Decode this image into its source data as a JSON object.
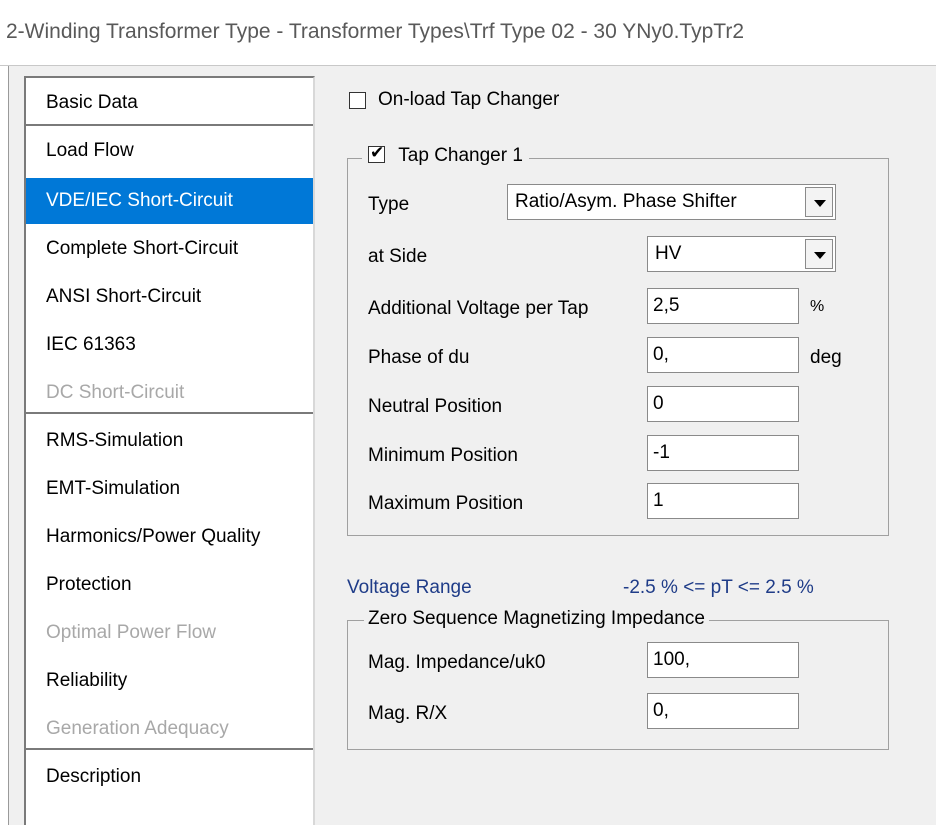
{
  "window": {
    "title": "2-Winding Transformer Type - Transformer Types\\Trf Type 02 - 30 YNy0.TypTr2"
  },
  "sidebar": {
    "items": [
      {
        "label": "Basic Data",
        "state": "normal"
      },
      {
        "label": "Load Flow",
        "state": "normal"
      },
      {
        "label": "VDE/IEC Short-Circuit",
        "state": "selected"
      },
      {
        "label": "Complete Short-Circuit",
        "state": "normal"
      },
      {
        "label": "ANSI Short-Circuit",
        "state": "normal"
      },
      {
        "label": "IEC 61363",
        "state": "normal"
      },
      {
        "label": "DC Short-Circuit",
        "state": "disabled"
      },
      {
        "label": "RMS-Simulation",
        "state": "normal"
      },
      {
        "label": "EMT-Simulation",
        "state": "normal"
      },
      {
        "label": "Harmonics/Power Quality",
        "state": "normal"
      },
      {
        "label": "Protection",
        "state": "normal"
      },
      {
        "label": "Optimal Power Flow",
        "state": "disabled"
      },
      {
        "label": "Reliability",
        "state": "normal"
      },
      {
        "label": "Generation Adequacy",
        "state": "disabled"
      },
      {
        "label": "Description",
        "state": "normal"
      }
    ],
    "selected_color": "#0078d7",
    "disabled_color": "#a8a8a8"
  },
  "onload_tap_changer": {
    "label": "On-load Tap Changer",
    "checked": false
  },
  "tap_changer_1": {
    "label": "Tap Changer 1",
    "checked": true,
    "checkmark": "✔",
    "type": {
      "label": "Type",
      "value": "Ratio/Asym. Phase Shifter"
    },
    "at_side": {
      "label": "at Side",
      "value": "HV"
    },
    "additional_voltage": {
      "label": "Additional Voltage per Tap",
      "value": "2,5",
      "unit": "%"
    },
    "phase_of_du": {
      "label": "Phase of du",
      "value": "0,",
      "unit": "deg"
    },
    "neutral_position": {
      "label": "Neutral Position",
      "value": "0"
    },
    "minimum_position": {
      "label": "Minimum Position",
      "value": "-1"
    },
    "maximum_position": {
      "label": "Maximum Position",
      "value": "1"
    }
  },
  "voltage_range": {
    "label": "Voltage Range",
    "value": "-2.5 % <= pT <= 2.5 %",
    "color": "#1f3c88"
  },
  "zero_sequence": {
    "legend": "Zero Sequence Magnetizing Impedance",
    "mag_impedance": {
      "label": "Mag. Impedance/uk0",
      "value": "100,"
    },
    "mag_rx": {
      "label": "Mag. R/X",
      "value": "0,"
    }
  }
}
